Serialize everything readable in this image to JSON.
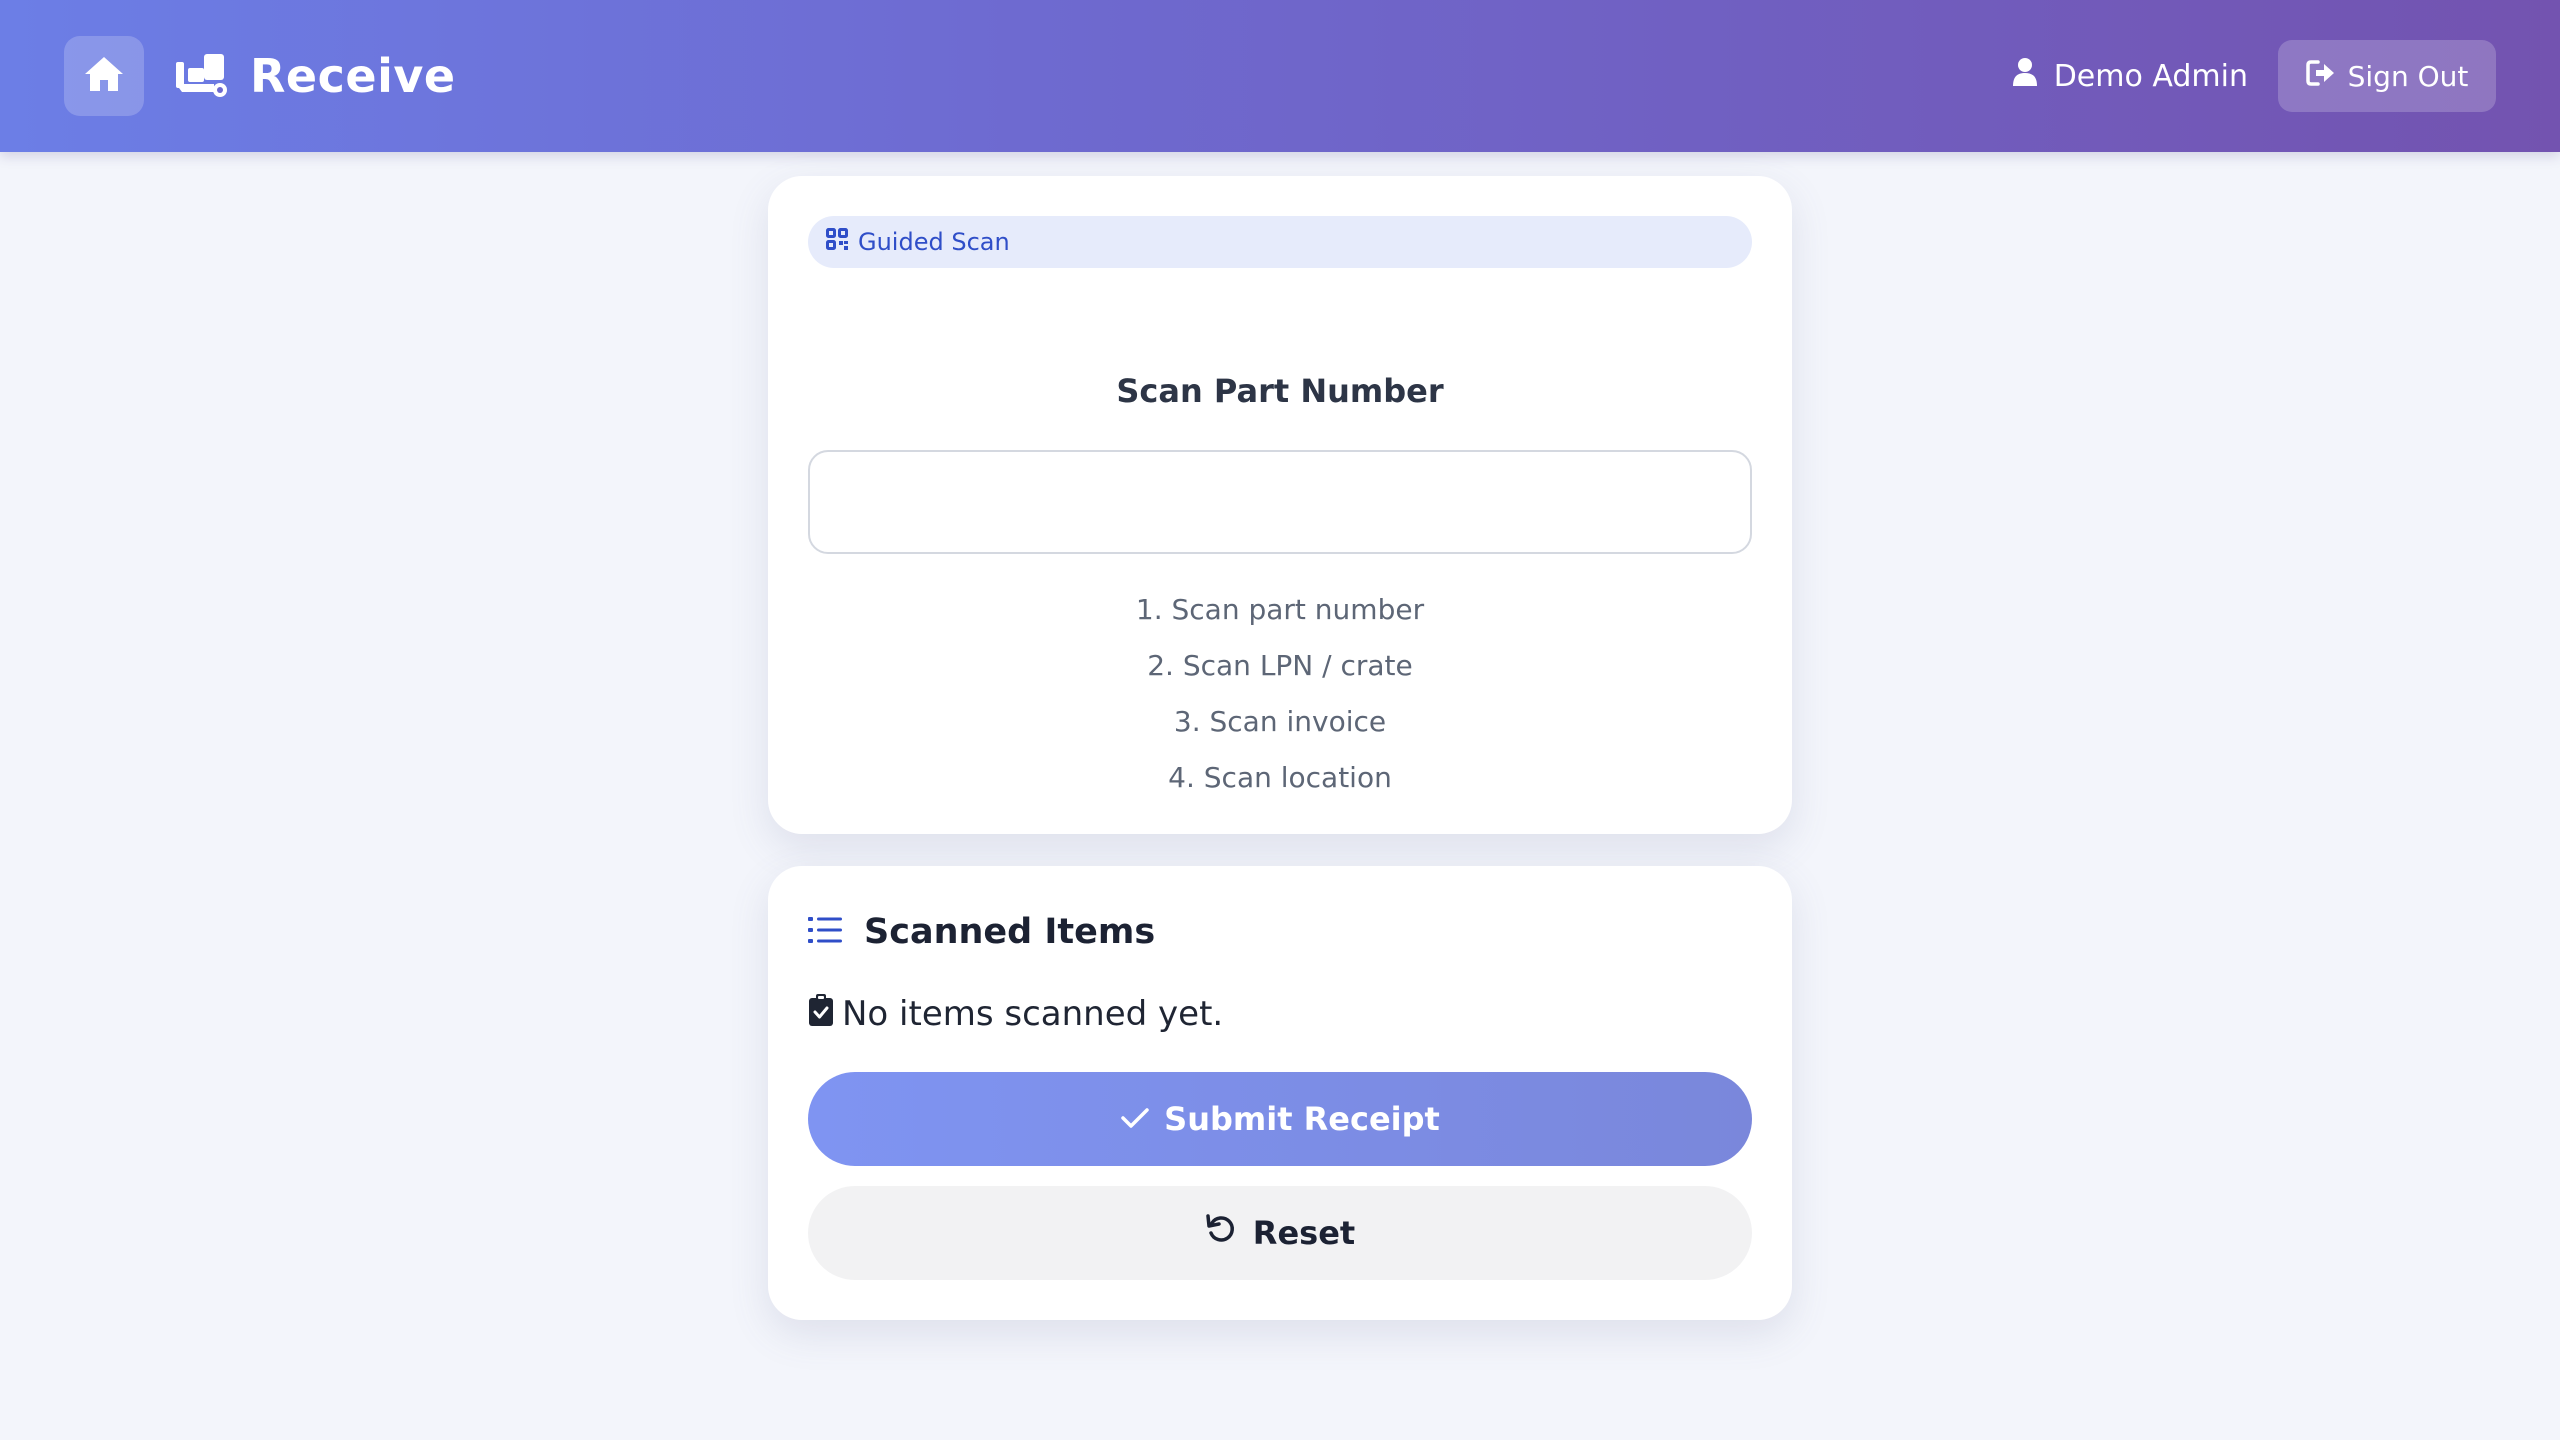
{
  "header": {
    "title": "Receive",
    "home_icon": "home-icon",
    "brand_icon": "dolly-icon",
    "user_name": "Demo Admin",
    "user_icon": "user-icon",
    "signout_label": "Sign Out",
    "signout_icon": "sign-out-icon"
  },
  "scan": {
    "badge_label": "Guided Scan",
    "badge_icon": "qrcode-icon",
    "heading": "Scan Part Number",
    "input_value": "",
    "input_placeholder": "",
    "steps": [
      "1. Scan part number",
      "2. Scan LPN / crate",
      "3. Scan invoice",
      "4. Scan location"
    ]
  },
  "items": {
    "title": "Scanned Items",
    "title_icon": "list-icon",
    "empty_message": "No items scanned yet.",
    "empty_icon": "clipboard-check-icon",
    "submit_label": "Submit Receipt",
    "submit_icon": "check-icon",
    "reset_label": "Reset",
    "reset_icon": "undo-icon"
  },
  "colors": {
    "header_gradient_start": "#6c7ee6",
    "header_gradient_end": "#7353b0",
    "accent": "#2f4ec8",
    "submit_gradient_start": "#7f94f2",
    "submit_gradient_end": "#7a87db",
    "page_background": "#f3f5fb"
  }
}
